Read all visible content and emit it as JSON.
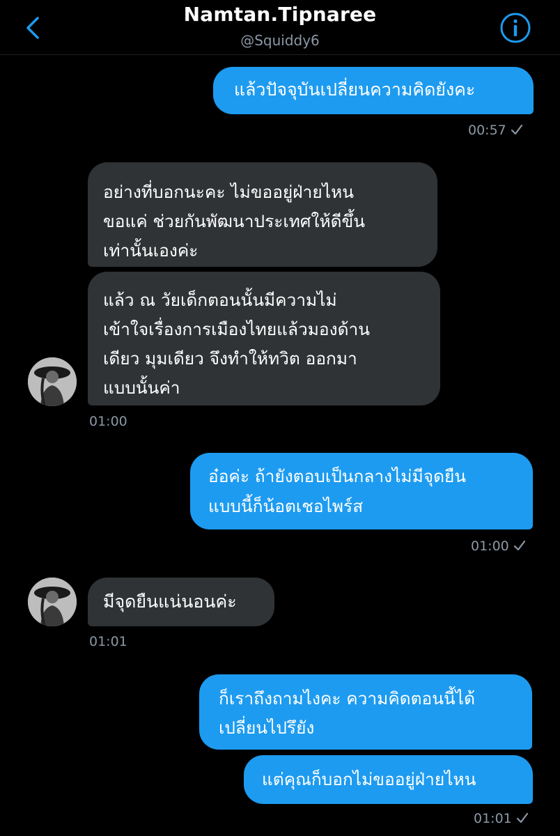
{
  "header": {
    "title": "Namtan.Tipnaree",
    "handle": "@Squiddy6",
    "back_icon": "chevron-left-icon",
    "info_icon": "info-circle-icon"
  },
  "colors": {
    "accent": "#1d9bf0",
    "received_bubble": "#2f3336",
    "background": "#000000",
    "muted_text": "#8b98a5"
  },
  "messages": [
    {
      "side": "sent",
      "text": "แล้วปัจจุบันเปลี่ยนความคิดยังคะ"
    },
    {
      "side": "sent_meta",
      "time": "00:57"
    },
    {
      "side": "received",
      "text": "อย่างที่บอกนะคะ ไม่ขออยู่ฝ่ายไหน\nขอแค่ ช่วยกันพัฒนาประเทศให้ดีขึ้น\nเท่านั้นเองค่ะ"
    },
    {
      "side": "received",
      "text": "แล้ว ณ วัยเด็กตอนนั้นมีความไม่\nเข้าใจเรื่องการเมืองไทยแล้วมองด้าน\nเดียว มุมเดียว จึงทำให้ทวิต ออกมา\nแบบนั้นค่า"
    },
    {
      "side": "received_meta",
      "time": "01:00"
    },
    {
      "side": "sent",
      "text": "อ๋อค่ะ ถ้ายังตอบเป็นกลางไม่มีจุดยืน\nแบบนี้ก็น้อตเชอไพร์ส"
    },
    {
      "side": "sent_meta",
      "time": "01:00"
    },
    {
      "side": "received",
      "text": "มีจุดยืนแน่นอนค่ะ"
    },
    {
      "side": "received_meta",
      "time": "01:01"
    },
    {
      "side": "sent",
      "text": "ก็เราถึงถามไงคะ ความคิดตอนนี้ได้\nเปลี่ยนไปรึยัง"
    },
    {
      "side": "sent",
      "text": "แต่คุณก็บอกไม่ขออยู่ฝ่ายไหน"
    },
    {
      "side": "sent_meta",
      "time": "01:01"
    }
  ]
}
